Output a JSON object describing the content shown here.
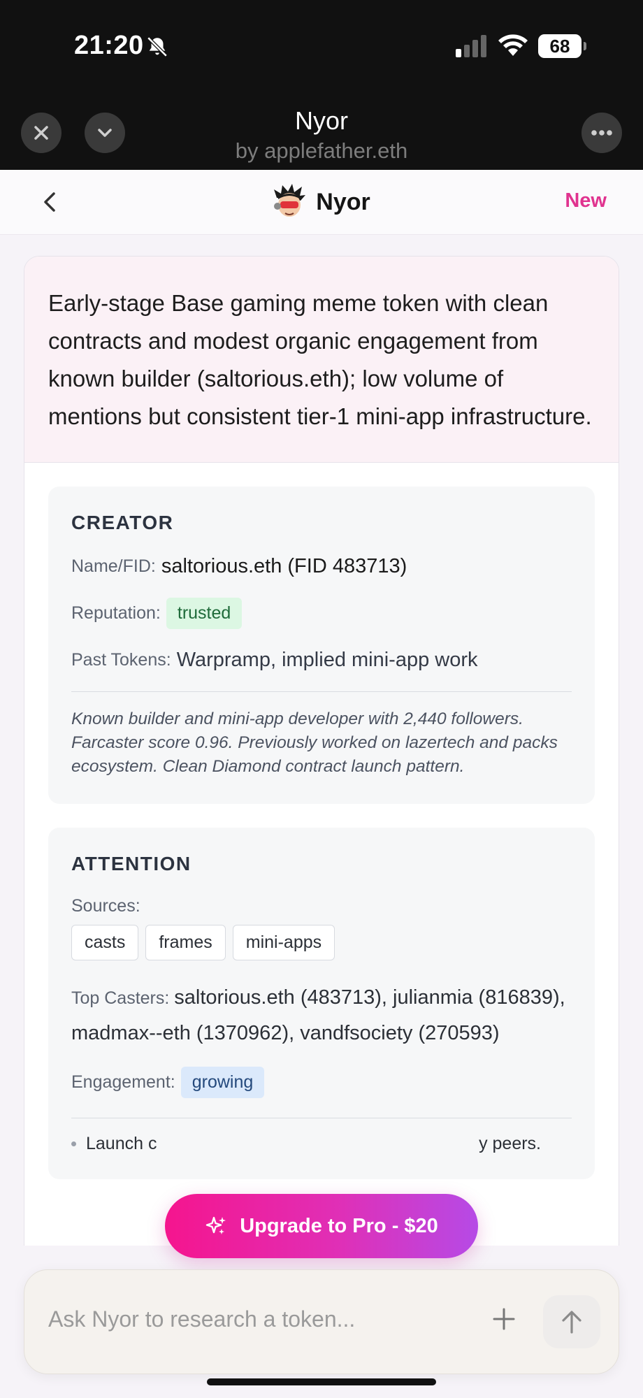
{
  "status_bar": {
    "time": "21:20",
    "battery": "68",
    "icons": [
      "bell-slash-icon",
      "signal-icon",
      "wifi-icon",
      "battery-icon"
    ]
  },
  "host_header": {
    "title": "Nyor",
    "subtitle": "by applefather.eth",
    "icons": [
      "close-icon",
      "chevron-down-icon",
      "more-icon"
    ]
  },
  "app_header": {
    "title": "Nyor",
    "new_label": "New",
    "accent_color": "#e0338f"
  },
  "summary": "Early-stage Base gaming meme token with clean contracts and modest organic engagement from known builder (saltorious.eth); low volume of mentions but consistent tier-1 mini-app infrastructure.",
  "creator": {
    "title": "CREATOR",
    "name_label": "Name/FID:",
    "name_value": "saltorious.eth (FID 483713)",
    "reputation_label": "Reputation:",
    "reputation_value": "trusted",
    "past_tokens_label": "Past Tokens:",
    "past_tokens_value": "Warpramp, implied mini-app work",
    "note": "Known builder and mini-app developer with 2,440 followers. Farcaster score 0.96. Previously worked on lazertech and packs ecosystem. Clean Diamond contract launch pattern."
  },
  "attention": {
    "title": "ATTENTION",
    "sources_label": "Sources:",
    "sources": [
      "casts",
      "frames",
      "mini-apps"
    ],
    "top_casters_label": "Top Casters:",
    "top_casters_value": "saltorious.eth (483713), julianmia (816839), madmax--eth (1370962), vandfsociety (270593)",
    "engagement_label": "Engagement:",
    "engagement_value": "growing",
    "bullet_start": "Launch c",
    "bullet_end": "y peers."
  },
  "upgrade": {
    "label": "Upgrade to Pro - $20"
  },
  "ask": {
    "placeholder": "Ask Nyor to research a token..."
  }
}
